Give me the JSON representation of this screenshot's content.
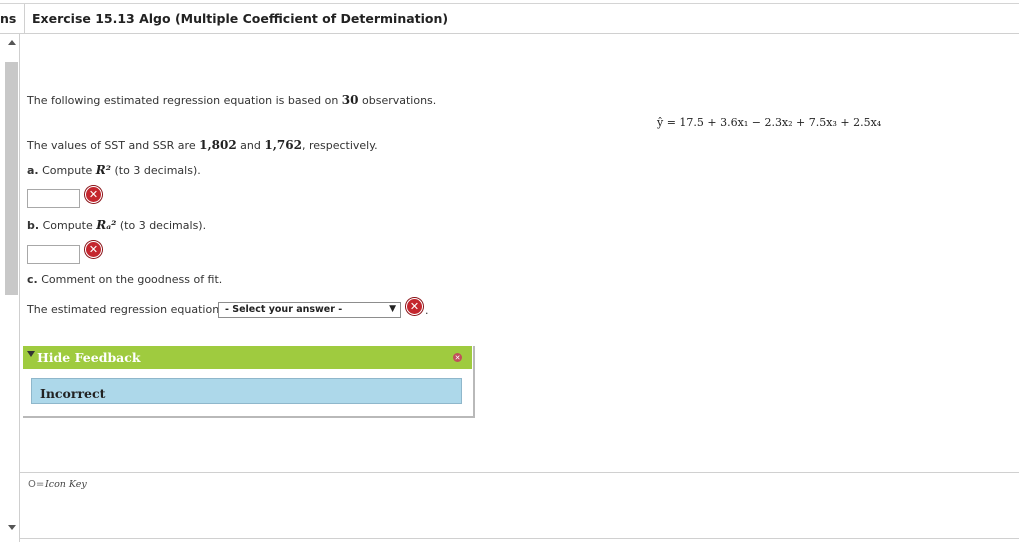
{
  "header": {
    "tab_fragment": "ns",
    "title": "Exercise 15.13 Algo (Multiple Coefficient of Determination)"
  },
  "equation": "ŷ = 17.5 + 3.6x₁ − 2.3x₂ + 7.5x₃ + 2.5x₄",
  "problem": {
    "intro_before": "The following estimated regression equation is based on ",
    "observations": "30",
    "intro_after": " observations.",
    "sst_before": "The values of SST and SSR are ",
    "sst_value": "1,802",
    "sst_mid": " and ",
    "ssr_value": "1,762",
    "sst_after": ", respectively.",
    "a_label": "a.",
    "a_compute": "Compute",
    "a_symbol": "R²",
    "a_note": "(to 3 decimals).",
    "b_label": "b.",
    "b_compute": "Compute",
    "b_symbol": "Rₐ²",
    "b_note": "(to 3 decimals).",
    "c_label": "c.",
    "c_text": "Comment on the goodness of fit.",
    "est_label": "The estimated regression equation",
    "a_value": "",
    "b_value": ""
  },
  "select": {
    "value": "- Select your answer -"
  },
  "feedback": {
    "toggle_label": "Hide Feedback",
    "message": "Incorrect"
  },
  "footer": {
    "icon_key_label": "Icon Key"
  },
  "icons": {
    "error": "close-circle-icon",
    "key": "key-icon"
  },
  "colors": {
    "feedback_header": "#9fcb3f",
    "feedback_message": "#add8ea",
    "error_red": "#c4262e"
  }
}
